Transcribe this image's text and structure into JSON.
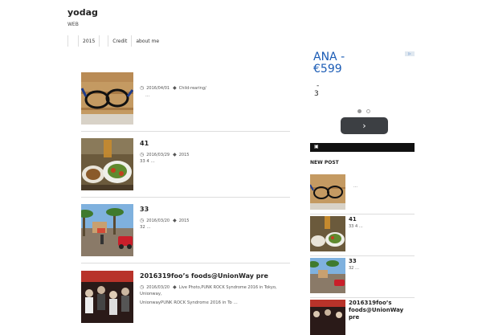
{
  "site": {
    "title": "yodag",
    "description": "WEB"
  },
  "nav": {
    "items": [
      "2015",
      "Credit",
      "about me"
    ]
  },
  "posts": [
    {
      "title": "",
      "date": "2016/04/01",
      "category": "Child-rearing/",
      "excerpt": "…"
    },
    {
      "title": "41",
      "date": "2016/03/29",
      "category": "2015",
      "excerpt": "33 4 …"
    },
    {
      "title": "33",
      "date": "2016/03/20",
      "category": "2015",
      "excerpt": "32 …"
    },
    {
      "title": "2016319foo’s foods@UnionWay pre",
      "date": "2016/03/20",
      "category": "Live Photo,PUNK ROCK Syndrome 2016 in Tokyo,",
      "category2": "Unionway,",
      "excerpt": "UnionwayPUNK ROCK Syndrome 2016 in To …"
    }
  ],
  "ad": {
    "headline": "ANA -\n€599",
    "line1": "-",
    "line2": "3",
    "button": "›",
    "badge": "▷"
  },
  "sidebar": {
    "bar_icon": "rss-icon",
    "new_post_heading": "NEW POST",
    "items": [
      {
        "title": "",
        "excerpt": "…"
      },
      {
        "title": "41",
        "excerpt": "33 4 …"
      },
      {
        "title": "33",
        "excerpt": "32 …"
      },
      {
        "title": "2016319foo’s foods@UnionWay pre",
        "excerpt": ""
      }
    ]
  },
  "colors": {
    "accent": "#1a5bb5",
    "bar": "#111111",
    "button": "#3c3f43"
  }
}
